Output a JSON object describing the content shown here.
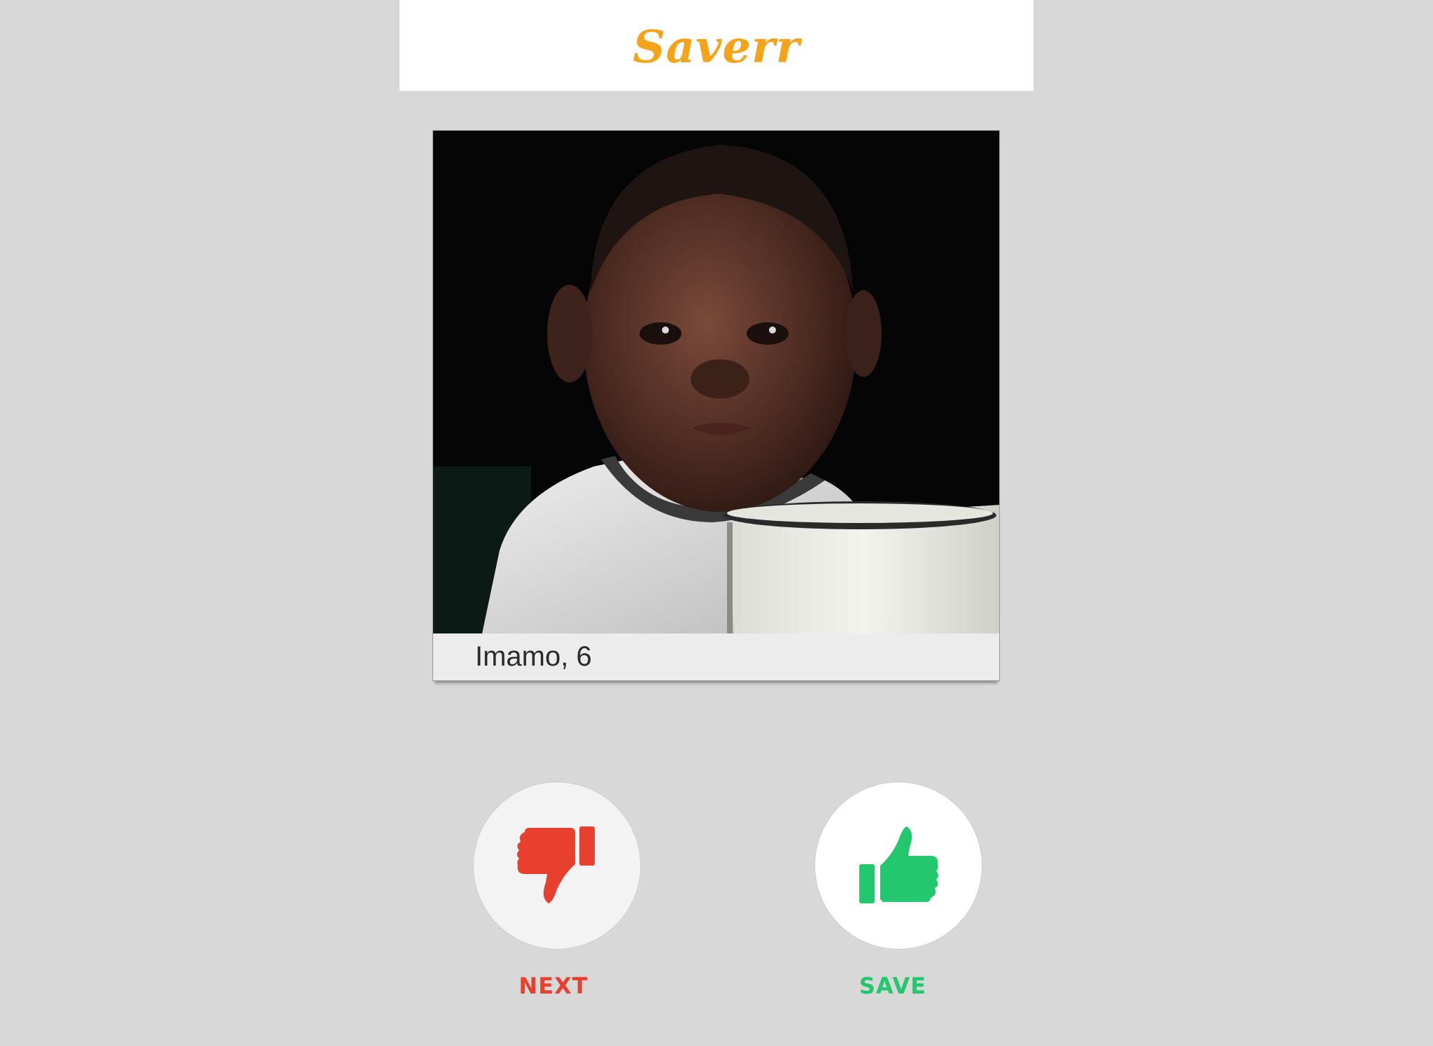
{
  "app": {
    "title": "Saverr",
    "brand_color": "#f5a31a",
    "background_color": "#d7d8d7"
  },
  "profile": {
    "caption": "Imamo, 6",
    "photo_icon": "child-portrait-photo"
  },
  "actions": {
    "next": {
      "label": "NEXT",
      "icon": "thumbs-down-icon",
      "color": "#e8402f"
    },
    "save": {
      "label": "SAVE",
      "icon": "thumbs-up-icon",
      "color": "#22c76e"
    }
  }
}
